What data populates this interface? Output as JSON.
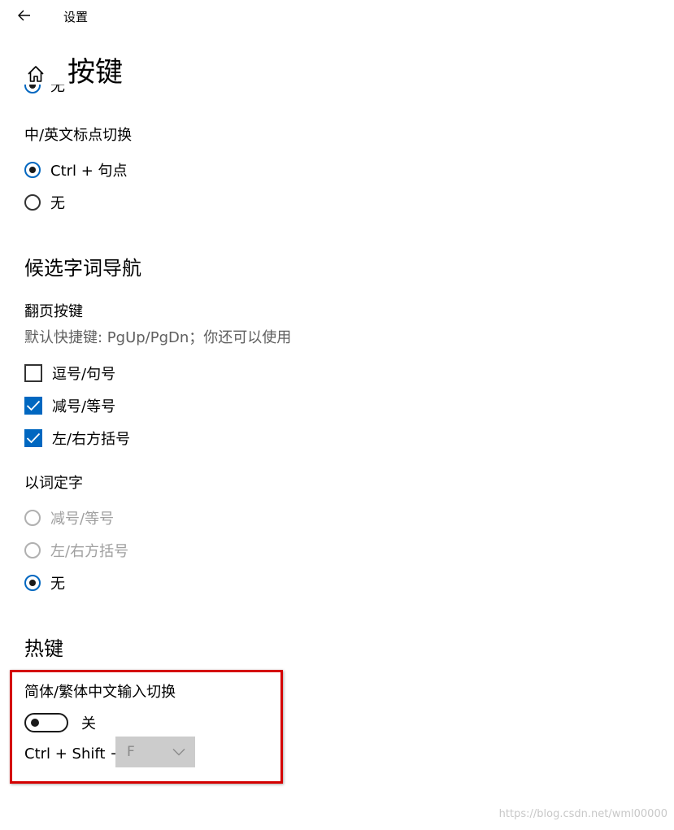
{
  "window": {
    "title": "设置"
  },
  "page": {
    "title": "按键"
  },
  "partial_option": {
    "label": "无"
  },
  "punct_switch": {
    "label": "中/英文标点切换",
    "options": [
      "Ctrl + 句点",
      "无"
    ],
    "selected": 0
  },
  "candidate_nav": {
    "title": "候选字词导航",
    "page_keys": {
      "label": "翻页按键",
      "description": "默认快捷键: PgUp/PgDn；你还可以使用",
      "options": [
        {
          "label": "逗号/句号",
          "checked": false
        },
        {
          "label": "减号/等号",
          "checked": true
        },
        {
          "label": "左/右方括号",
          "checked": true
        }
      ]
    },
    "word_to_char": {
      "label": "以词定字",
      "options": [
        {
          "label": "减号/等号",
          "disabled": true
        },
        {
          "label": "左/右方括号",
          "disabled": true
        },
        {
          "label": "无",
          "disabled": false
        }
      ],
      "selected": 2
    }
  },
  "hotkeys": {
    "title": "热键",
    "trad_simp_switch": {
      "label": "简体/繁体中文输入切换",
      "toggle_state": "关",
      "toggle_on": false,
      "shortcut_prefix": "Ctrl + Shift +",
      "key_value": "F"
    }
  },
  "watermark": "https://blog.csdn.net/wml00000",
  "colors": {
    "accent": "#0067c0",
    "highlight_border": "#d40000"
  },
  "icons": {
    "back": "back-arrow-icon",
    "home": "home-icon",
    "check": "checkmark-icon",
    "dropdown": "chevron-down-icon"
  }
}
